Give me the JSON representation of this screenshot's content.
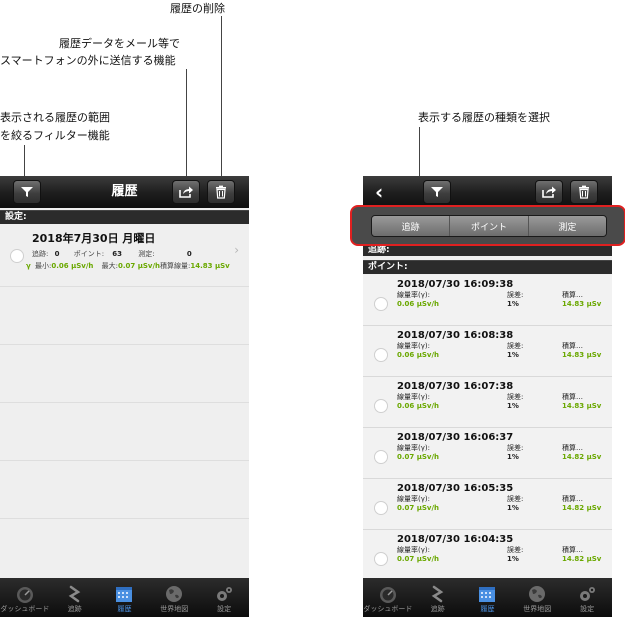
{
  "annotations": {
    "delete": "履歴の削除",
    "export_line1": "履歴データをメール等で",
    "export_line2": "スマートフォンの外に送信する機能",
    "filter_line1": "表示される履歴の範囲",
    "filter_line2": "を絞るフィルター機能",
    "type_select": "表示する履歴の種類を選択"
  },
  "left_screen": {
    "title": "履歴",
    "section_label": "設定:",
    "item": {
      "date": "2018年7月30日 月曜日",
      "track_label": "追跡:",
      "track_value": "0",
      "point_label": "ポイント:",
      "point_value": "63",
      "measure_label": "測定:",
      "measure_value": "0",
      "prefix": "γ",
      "min_label": "最小:",
      "min_value": "0.06 μSv/h",
      "max_label": "最大:",
      "max_value": "0.07 μSv/h",
      "cumulative_label": "積算線量:",
      "cumulative_value": "14.83 μSv"
    }
  },
  "right_screen": {
    "back_glyph": "‹",
    "segments": [
      "追跡",
      "ポイント",
      "測定"
    ],
    "section_track": "追跡:",
    "section_point": "ポイント:",
    "col_rate": "線量率(γ):",
    "col_error": "誤差:",
    "col_cumulative": "積算…",
    "entries": [
      {
        "datetime": "2018/07/30 16:09:38",
        "rate": "0.06 μSv/h",
        "error": "1%",
        "cumulative": "14.83 μSv"
      },
      {
        "datetime": "2018/07/30 16:08:38",
        "rate": "0.06 μSv/h",
        "error": "1%",
        "cumulative": "14.83 μSv"
      },
      {
        "datetime": "2018/07/30 16:07:38",
        "rate": "0.06 μSv/h",
        "error": "1%",
        "cumulative": "14.83 μSv"
      },
      {
        "datetime": "2018/07/30 16:06:37",
        "rate": "0.07 μSv/h",
        "error": "1%",
        "cumulative": "14.82 μSv"
      },
      {
        "datetime": "2018/07/30 16:05:35",
        "rate": "0.07 μSv/h",
        "error": "1%",
        "cumulative": "14.82 μSv"
      },
      {
        "datetime": "2018/07/30 16:04:35",
        "rate": "0.07 μSv/h",
        "error": "1%",
        "cumulative": "14.82 μSv"
      }
    ]
  },
  "tabbar": {
    "items": [
      {
        "label": "ダッシュボード",
        "icon": "gauge-icon"
      },
      {
        "label": "追跡",
        "icon": "track-icon"
      },
      {
        "label": "履歴",
        "icon": "calendar-icon"
      },
      {
        "label": "世界地図",
        "icon": "globe-icon"
      },
      {
        "label": "設定",
        "icon": "gear-icon"
      }
    ],
    "active_index": 2
  },
  "colors": {
    "accent_blue": "#4a90e2",
    "value_green": "#6aa800",
    "highlight_red": "#e02020"
  }
}
